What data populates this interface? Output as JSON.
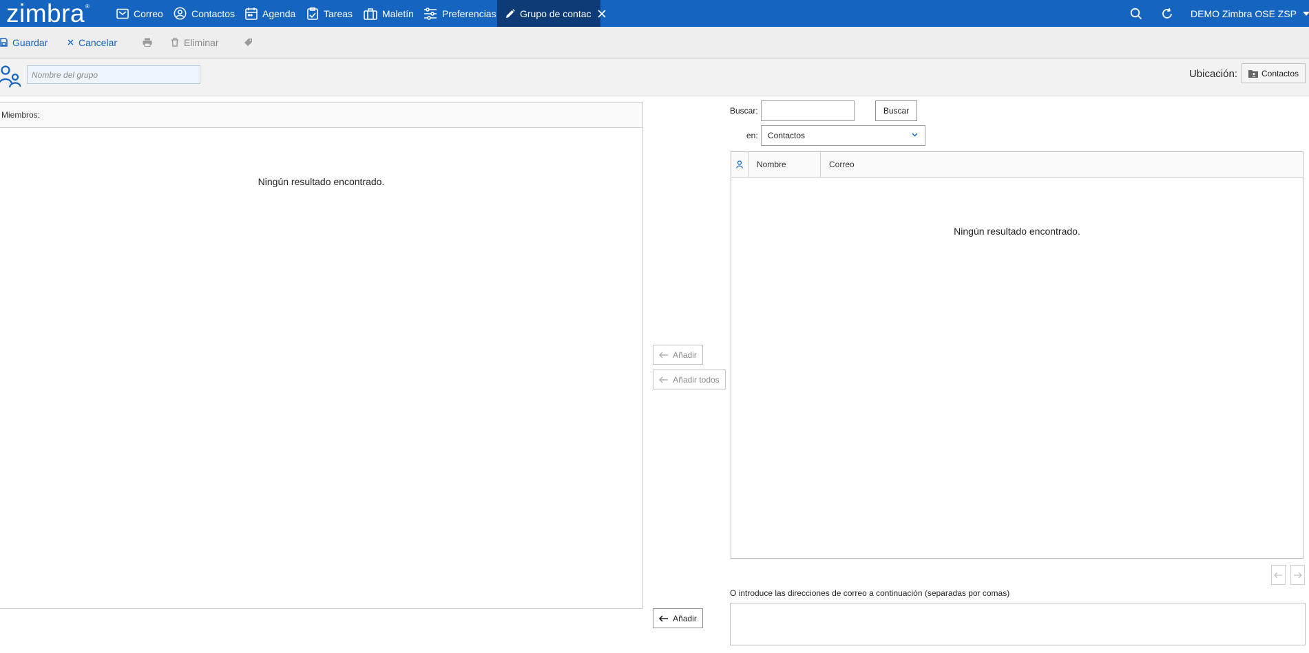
{
  "brand": {
    "logo_text": "zimbra",
    "logo_mark": "®"
  },
  "nav": {
    "items": [
      {
        "label": "Correo",
        "icon": "mail-icon"
      },
      {
        "label": "Contactos",
        "icon": "contacts-icon"
      },
      {
        "label": "Agenda",
        "icon": "calendar-icon"
      },
      {
        "label": "Tareas",
        "icon": "tasks-icon"
      },
      {
        "label": "Maletín",
        "icon": "briefcase-icon"
      },
      {
        "label": "Preferencias",
        "icon": "preferences-icon"
      }
    ],
    "active_tab": {
      "label": "Grupo de contac",
      "icon": "pencil-icon"
    }
  },
  "topbar_right": {
    "user": "DEMO Zimbra OSE ZSP"
  },
  "toolbar": {
    "save": "Guardar",
    "cancel": "Cancelar",
    "delete": "Eliminar"
  },
  "group": {
    "name_placeholder": "Nombre del grupo",
    "location_label": "Ubicación:",
    "location_value": "Contactos"
  },
  "members": {
    "header": "Miembros:",
    "empty": "Ningún resultado encontrado."
  },
  "actions": {
    "add": "Añadir",
    "add_all": "Añadir todos",
    "add_manual": "Añadir"
  },
  "search": {
    "label": "Buscar:",
    "button": "Buscar",
    "in_label": "en:",
    "in_value": "Contactos"
  },
  "results": {
    "columns": [
      "Nombre",
      "Correo"
    ],
    "empty": "Ningún resultado encontrado."
  },
  "manual": {
    "hint": "O introduce las direcciones de correo a continuación (separadas por comas)"
  },
  "colors": {
    "brand_blue": "#1565c0",
    "active_tab": "#0d3b76",
    "toolbar_bg": "#eeeeee"
  }
}
